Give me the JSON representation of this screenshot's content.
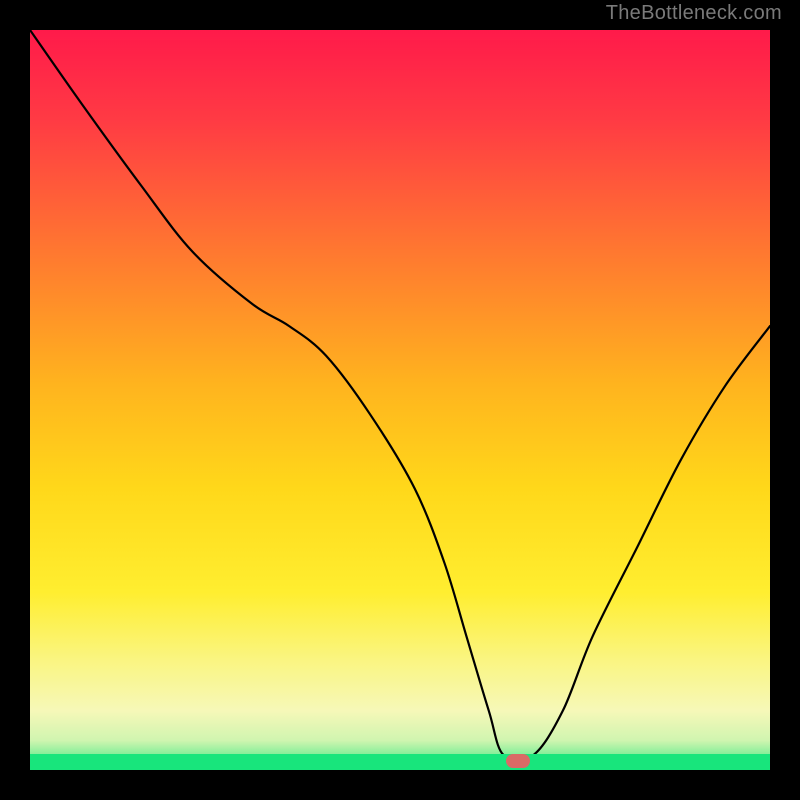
{
  "watermark": "TheBottleneck.com",
  "chart_data": {
    "type": "line",
    "title": "",
    "xlabel": "",
    "ylabel": "",
    "xlim": [
      0,
      100
    ],
    "ylim": [
      0,
      100
    ],
    "grid": false,
    "background_gradient": {
      "top_color": "#ff1a4a",
      "mid1_color": "#ff9a20",
      "mid2_color": "#ffe020",
      "mid3_color": "#faf99a",
      "bottom_color": "#18e57c"
    },
    "series": [
      {
        "name": "bottleneck-curve",
        "color": "#000000",
        "x_values": [
          0,
          7,
          15,
          22,
          30,
          35,
          40,
          46,
          52,
          56,
          59,
          62,
          64,
          68,
          72,
          76,
          82,
          88,
          94,
          100
        ],
        "y_values": [
          100,
          90,
          79,
          70,
          63,
          60,
          56,
          48,
          38,
          28,
          18,
          8,
          2,
          2,
          8,
          18,
          30,
          42,
          52,
          60
        ]
      }
    ],
    "optimal_marker": {
      "position_x_pct": 66,
      "position_y_pct": 1.2,
      "color": "#d96a66",
      "label": "optimal-region"
    }
  }
}
